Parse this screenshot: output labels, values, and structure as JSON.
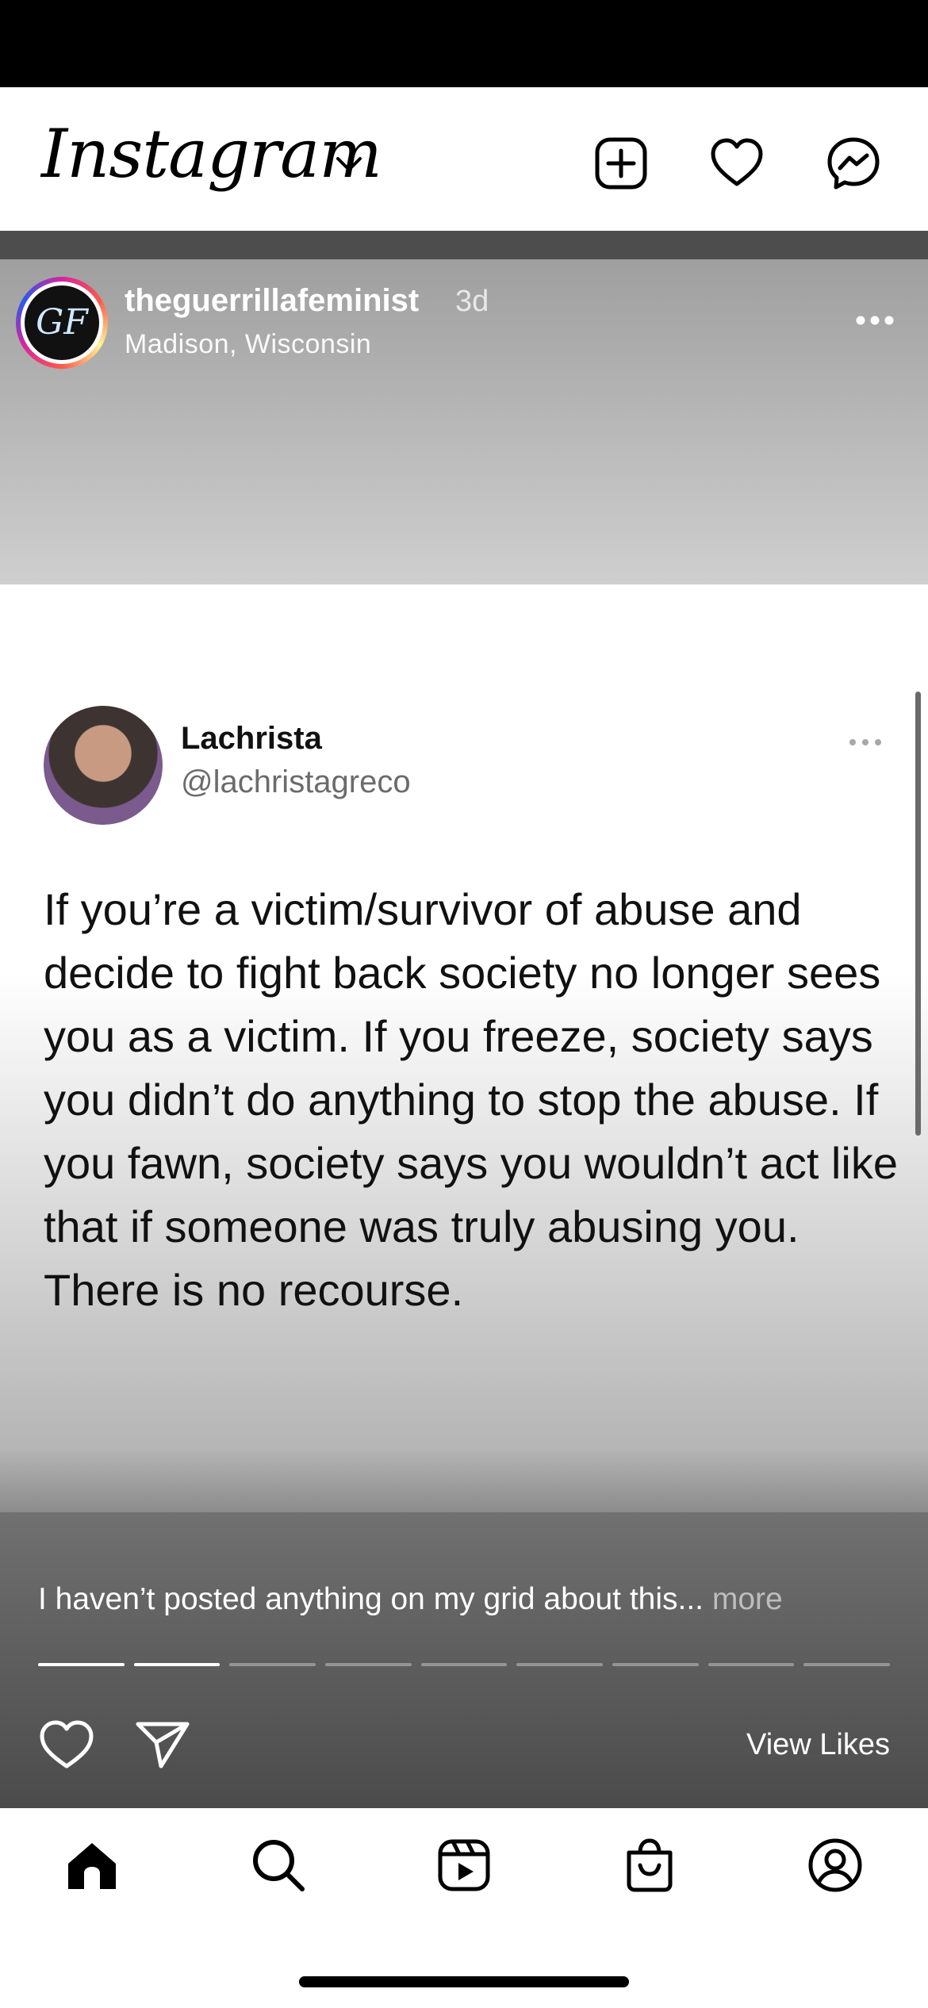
{
  "app": {
    "brand": "Instagram"
  },
  "post": {
    "username": "theguerrillafeminist",
    "time_ago": "3d",
    "location": "Madison, Wisconsin",
    "avatar_initials": "GF"
  },
  "tweet": {
    "name": "Lachrista",
    "handle": "@lachristagreco",
    "text": "If you’re a victim/survivor of abuse and decide to fight back society no longer sees you as a victim. If you freeze, society says you didn’t do anything to stop the abuse. If you fawn, society says you wouldn’t act like that if someone was truly abusing you. There is no recourse."
  },
  "story": {
    "caption": "I haven’t posted anything on my grid about this...",
    "caption_more": "more",
    "view_likes": "View Likes",
    "segments_total": 9,
    "segments_completed": 2
  },
  "icons": {
    "top_bar": [
      "new-post-icon",
      "heart-icon",
      "messenger-icon"
    ],
    "tab_bar": [
      "home-icon",
      "search-icon",
      "reels-icon",
      "shop-icon",
      "profile-icon"
    ]
  }
}
